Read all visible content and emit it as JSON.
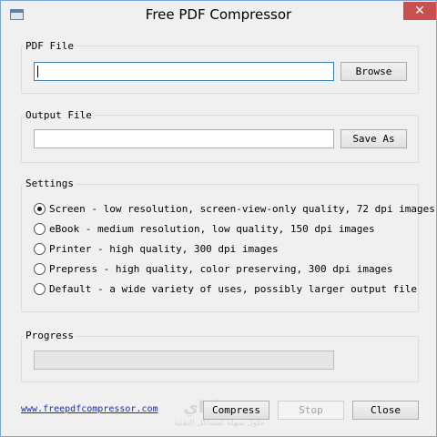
{
  "window": {
    "title": "Free PDF Compressor"
  },
  "pdf_file": {
    "label": "PDF File",
    "value": "",
    "browse_label": "Browse"
  },
  "output_file": {
    "label": "Output File",
    "value": "",
    "save_as_label": "Save As"
  },
  "settings": {
    "label": "Settings",
    "options": [
      {
        "label": "Screen - low resolution, screen-view-only quality, 72 dpi images",
        "checked": true
      },
      {
        "label": "eBook - medium resolution, low quality, 150 dpi images",
        "checked": false
      },
      {
        "label": "Printer - high quality, 300 dpi images",
        "checked": false
      },
      {
        "label": "Prepress - high quality, color preserving, 300 dpi images",
        "checked": false
      },
      {
        "label": "Default - a wide variety of uses, possibly larger output file",
        "checked": false
      }
    ]
  },
  "progress": {
    "label": "Progress",
    "value": 0
  },
  "footer": {
    "link": "www.freepdfcompressor.com",
    "compress_label": "Compress",
    "stop_label": "Stop",
    "close_label": "Close"
  },
  "watermark": {
    "brand": "ايجي إزاي",
    "tagline": "حلول سهلة لمشاكل التقنية"
  }
}
